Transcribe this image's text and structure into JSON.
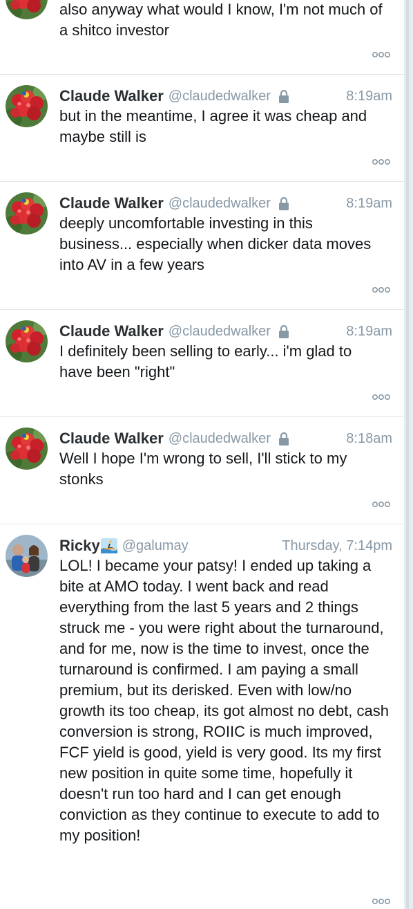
{
  "tweets": [
    {
      "text": "also anyway what would I know, I'm not much of a shitco investor"
    },
    {
      "name": "Claude Walker",
      "handle": "@claudedwalker",
      "time": "8:19am",
      "text": "but in the meantime, I agree it was cheap and maybe still is"
    },
    {
      "name": "Claude Walker",
      "handle": "@claudedwalker",
      "time": "8:19am",
      "text": "deeply uncomfortable investing in this business... especially when dicker data moves into AV in a few years"
    },
    {
      "name": "Claude Walker",
      "handle": "@claudedwalker",
      "time": "8:19am",
      "text": "I definitely been selling to early... i'm glad to have been \"right\""
    },
    {
      "name": "Claude Walker",
      "handle": "@claudedwalker",
      "time": "8:18am",
      "text": "Well I hope I'm wrong to sell, I'll stick to my stonks"
    },
    {
      "name": "Ricky",
      "handle": "@galumay",
      "time": "Thursday, 7:14pm",
      "text": "LOL! I became your patsy! I ended up taking a bite at AMO today. I went back and read everything from the last 5 years and 2 things struck me - you were right about the turnaround, and for me, now is the time to invest, once the turnaround is confirmed. I am paying a small premium, but its derisked. Even with low/no growth its too cheap, its got almost no debt, cash conversion is strong, ROIIC is much improved, FCF yield is good, yield is very good. Its my first new position in quite some time, hopefully it doesn't run too hard and I can get enough conviction as they continue to execute to add to my position!"
    }
  ],
  "icons": {
    "lock": "lock-icon",
    "more": "more-options-icon",
    "emoji": "surfer-emoji-icon"
  },
  "colors": {
    "text": "#14171a",
    "muted": "#8899a6",
    "divider": "#dfe4e8"
  }
}
